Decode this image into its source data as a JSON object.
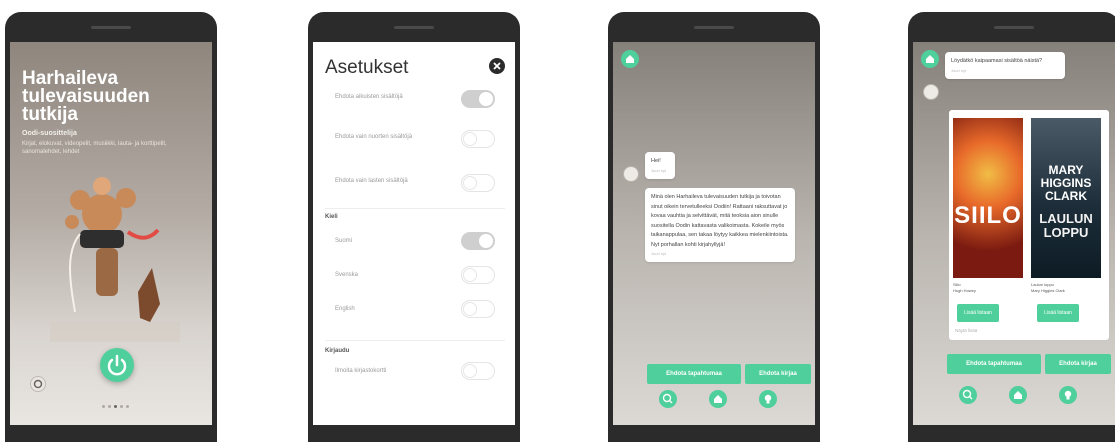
{
  "intro": {
    "title": "Harhaileva tulevaisuuden tutkija",
    "subtitle": "Oodi-suosittelija",
    "description": "Kirjat, elokuvat, videopelit, musiikki, lauta- ja korttipelit, sanomalehdet, lehdet"
  },
  "settings": {
    "title": "Asetukset",
    "options": [
      {
        "label": "Ehdota aikuisten sisältöjä",
        "on": true
      },
      {
        "label": "Ehdota vain nuorten sisältöjä",
        "on": false
      },
      {
        "label": "Ehdota vain lasten sisältöjä",
        "on": false
      }
    ],
    "language_label": "Kieli",
    "languages": [
      {
        "label": "Suomi",
        "on": true
      },
      {
        "label": "Svenska",
        "on": false
      },
      {
        "label": "English",
        "on": false
      }
    ],
    "login_label": "Kirjaudu",
    "login_option": {
      "label": "Ilmoita kirjastokortti",
      "on": false
    }
  },
  "chat": {
    "greeting": "Hei!",
    "greeting_time": "Juuri nyt",
    "message": "Minä olen Harhaileva tulevaisuuden tutkija ja toivotan sinut oikein tervetulleeksi Oodiin! Rattaani raksuttavat jo kovaa vauhtia ja selvittävät, mitä teoksia aion sinulle suositella Oodin kattavasta valikoimasta. Kokeile myös taikanappulaa, sen takaa löytyy kaikkea mielenkiintoista. Nyt porhallan kohti kirjahyllyjä!",
    "message_time": "Juuri nyt",
    "buttons": [
      "Ehdota tapahtumaa",
      "Ehdota kirjaa"
    ]
  },
  "result": {
    "question": "Löydätkö kaipaamasi sisältöä näistä?",
    "question_time": "Juuri nyt",
    "books": [
      {
        "cover_title": "SIILO",
        "title": "Siilo",
        "author": "Hugh Howey",
        "button": "Lisää listaan"
      },
      {
        "cover_author": "MARY HIGGINS CLARK",
        "cover_title": "LAULUN LOPPU",
        "title": "Laulun loppu",
        "author": "Mary Higgins Clark",
        "button": "Lisää listaan"
      }
    ],
    "more": "Näytä lisää",
    "buttons": [
      "Ehdota tapahtumaa",
      "Ehdota kirjaa"
    ]
  },
  "colors": {
    "accent": "#4fcf9b",
    "dark": "#2b2b2b"
  }
}
